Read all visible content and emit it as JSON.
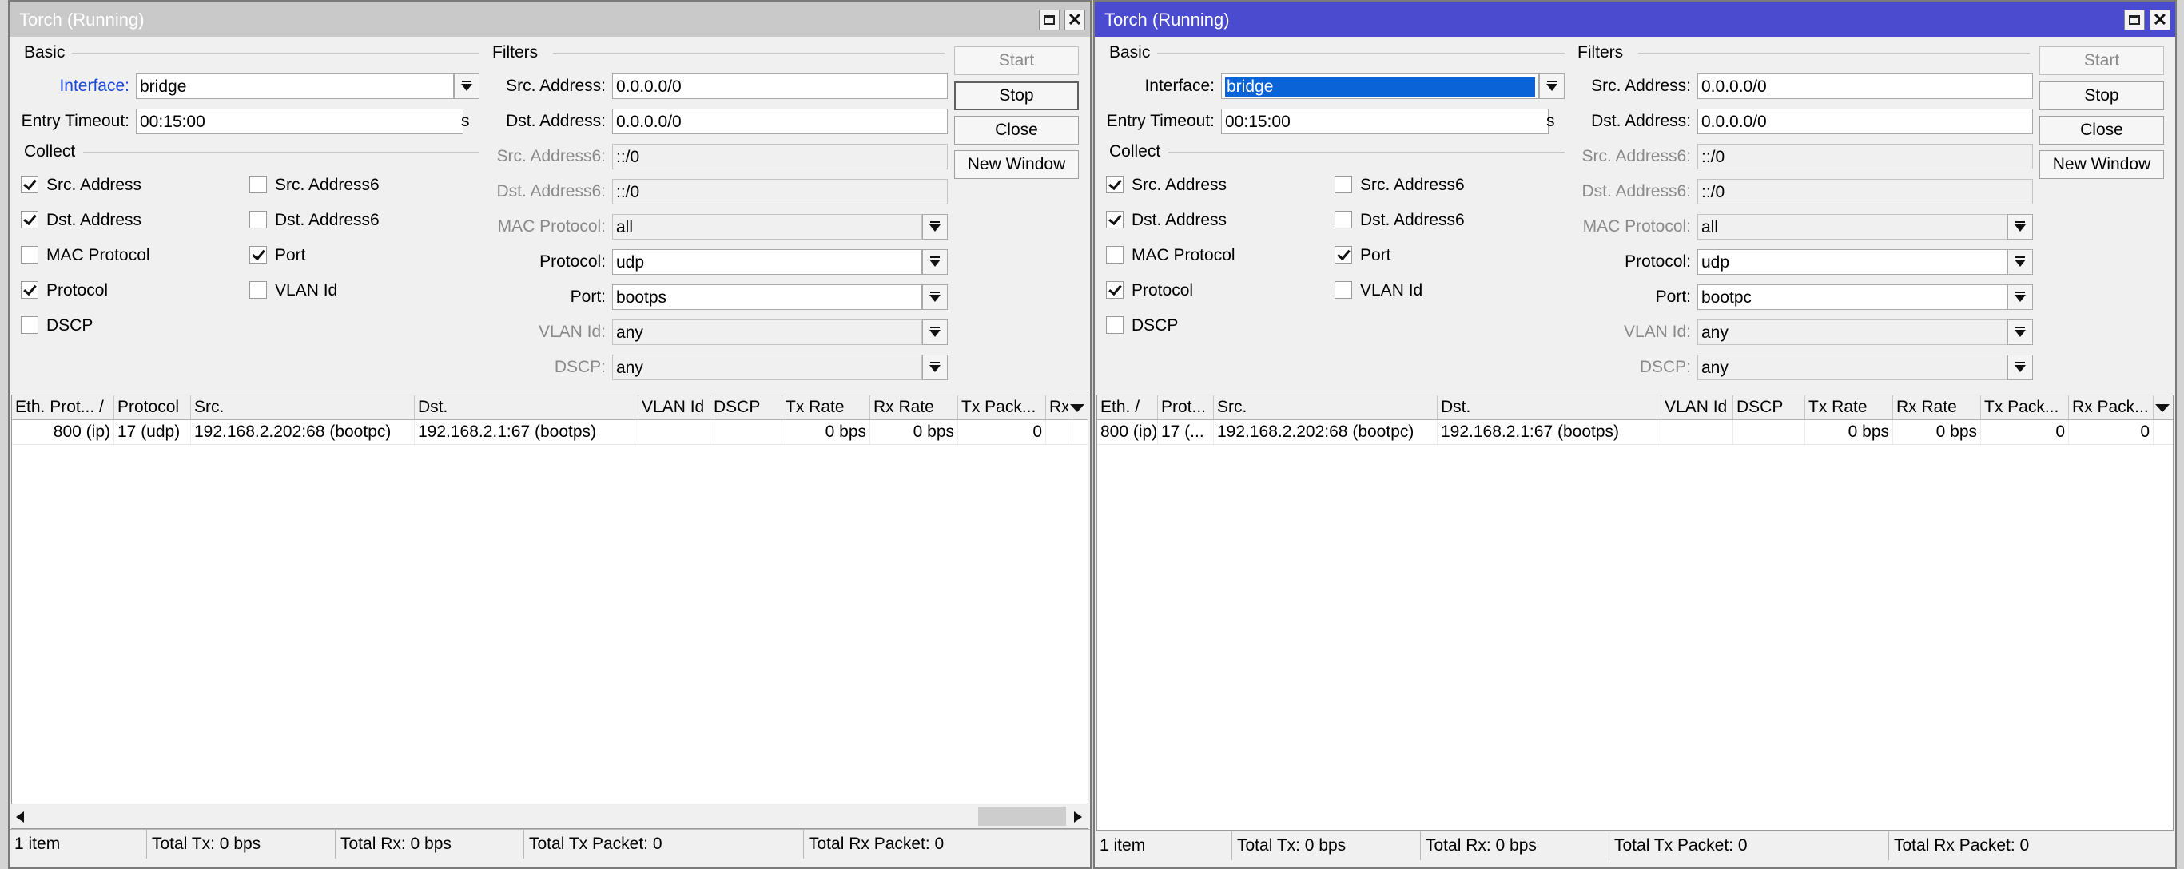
{
  "window1": {
    "title": "Torch (Running)",
    "basic_label": "Basic",
    "filters_label": "Filters",
    "collect_label": "Collect",
    "interface": {
      "label": "Interface:",
      "value": "bridge"
    },
    "entry_timeout": {
      "label": "Entry Timeout:",
      "value": "00:15:00",
      "unit": "s"
    },
    "collect": [
      {
        "label": "Src. Address",
        "checked": true
      },
      {
        "label": "Src. Address6",
        "checked": false
      },
      {
        "label": "Dst. Address",
        "checked": true
      },
      {
        "label": "Dst. Address6",
        "checked": false
      },
      {
        "label": "MAC Protocol",
        "checked": false
      },
      {
        "label": "Port",
        "checked": true
      },
      {
        "label": "Protocol",
        "checked": true
      },
      {
        "label": "VLAN Id",
        "checked": false
      },
      {
        "label": "DSCP",
        "checked": false
      }
    ],
    "filters": [
      {
        "label": "Src. Address:",
        "value": "0.0.0.0/0"
      },
      {
        "label": "Dst. Address:",
        "value": "0.0.0.0/0"
      },
      {
        "label": "Src. Address6:",
        "value": "::/0"
      },
      {
        "label": "Dst. Address6:",
        "value": "::/0"
      },
      {
        "label": "MAC Protocol:",
        "value": "all"
      },
      {
        "label": "Protocol:",
        "value": "udp"
      },
      {
        "label": "Port:",
        "value": "bootps"
      },
      {
        "label": "VLAN Id:",
        "value": "any"
      },
      {
        "label": "DSCP:",
        "value": "any"
      }
    ],
    "buttons": {
      "start": "Start",
      "stop": "Stop",
      "close": "Close",
      "new_window": "New Window"
    },
    "columns": [
      "Eth. Prot... /",
      "Protocol",
      "Src.",
      "Dst.",
      "VLAN Id",
      "DSCP",
      "Tx Rate",
      "Rx Rate",
      "Tx Pack...",
      "Rx"
    ],
    "rows": [
      {
        "eth": "800 (ip)",
        "protocol": "17 (udp)",
        "src": "192.168.2.202:68 (bootpc)",
        "dst": "192.168.2.1:67 (bootps)",
        "vlan": "",
        "dscp": "",
        "tx_rate": "0 bps",
        "rx_rate": "0 bps",
        "tx_pack": "0",
        "rx_pack": ""
      }
    ],
    "status": {
      "items": "1 item",
      "total_tx": "Total Tx: 0 bps",
      "total_rx": "Total Rx: 0 bps",
      "total_tx_packet": "Total Tx Packet: 0",
      "total_rx_packet": "Total Rx Packet: 0"
    }
  },
  "window2": {
    "title": "Torch (Running)",
    "basic_label": "Basic",
    "filters_label": "Filters",
    "collect_label": "Collect",
    "interface": {
      "label": "Interface:",
      "value": "bridge"
    },
    "entry_timeout": {
      "label": "Entry Timeout:",
      "value": "00:15:00",
      "unit": "s"
    },
    "collect": [
      {
        "label": "Src. Address",
        "checked": true
      },
      {
        "label": "Src. Address6",
        "checked": false
      },
      {
        "label": "Dst. Address",
        "checked": true
      },
      {
        "label": "Dst. Address6",
        "checked": false
      },
      {
        "label": "MAC Protocol",
        "checked": false
      },
      {
        "label": "Port",
        "checked": true
      },
      {
        "label": "Protocol",
        "checked": true
      },
      {
        "label": "VLAN Id",
        "checked": false
      },
      {
        "label": "DSCP",
        "checked": false
      }
    ],
    "filters": [
      {
        "label": "Src. Address:",
        "value": "0.0.0.0/0"
      },
      {
        "label": "Dst. Address:",
        "value": "0.0.0.0/0"
      },
      {
        "label": "Src. Address6:",
        "value": "::/0"
      },
      {
        "label": "Dst. Address6:",
        "value": "::/0"
      },
      {
        "label": "MAC Protocol:",
        "value": "all"
      },
      {
        "label": "Protocol:",
        "value": "udp"
      },
      {
        "label": "Port:",
        "value": "bootpc"
      },
      {
        "label": "VLAN Id:",
        "value": "any"
      },
      {
        "label": "DSCP:",
        "value": "any"
      }
    ],
    "buttons": {
      "start": "Start",
      "stop": "Stop",
      "close": "Close",
      "new_window": "New Window"
    },
    "columns": [
      "Eth. /",
      "Prot...",
      "Src.",
      "Dst.",
      "VLAN Id",
      "DSCP",
      "Tx Rate",
      "Rx Rate",
      "Tx Pack...",
      "Rx Pack..."
    ],
    "rows": [
      {
        "eth": "800 (ip)",
        "protocol": "17 (...",
        "src": "192.168.2.202:68 (bootpc)",
        "dst": "192.168.2.1:67 (bootps)",
        "vlan": "",
        "dscp": "",
        "tx_rate": "0 bps",
        "rx_rate": "0 bps",
        "tx_pack": "0",
        "rx_pack": "0"
      }
    ],
    "status": {
      "items": "1 item",
      "total_tx": "Total Tx: 0 bps",
      "total_rx": "Total Rx: 0 bps",
      "total_tx_packet": "Total Tx Packet: 0",
      "total_rx_packet": "Total Rx Packet: 0"
    }
  },
  "colors": {
    "active_title": "#4b4bd0",
    "inactive_title": "#c9c9c9",
    "link_label": "#1c49d8",
    "selection": "#0a64d8"
  }
}
